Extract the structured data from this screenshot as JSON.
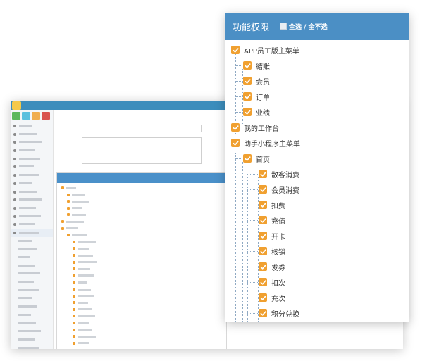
{
  "panel": {
    "title": "功能权限",
    "select_all": "全选",
    "separator": " / ",
    "deselect_all": "全不选"
  },
  "tree": [
    {
      "label": "APP员工版主菜单",
      "level": 0,
      "checked": true
    },
    {
      "label": "結账",
      "level": 1,
      "checked": true
    },
    {
      "label": "会员",
      "level": 1,
      "checked": true
    },
    {
      "label": "订单",
      "level": 1,
      "checked": true
    },
    {
      "label": "业绩",
      "level": 1,
      "checked": true
    },
    {
      "label": "我的工作台",
      "level": 0,
      "checked": true
    },
    {
      "label": "助手小程序主菜单",
      "level": 0,
      "checked": true
    },
    {
      "label": "首页",
      "level": 1,
      "checked": true
    },
    {
      "label": "散客消费",
      "level": 2,
      "checked": true
    },
    {
      "label": "会员消费",
      "level": 2,
      "checked": true
    },
    {
      "label": "扣费",
      "level": 2,
      "checked": true
    },
    {
      "label": "充值",
      "level": 2,
      "checked": true
    },
    {
      "label": "开卡",
      "level": 2,
      "checked": true
    },
    {
      "label": "核销",
      "level": 2,
      "checked": true
    },
    {
      "label": "发券",
      "level": 2,
      "checked": true
    },
    {
      "label": "扣次",
      "level": 2,
      "checked": true
    },
    {
      "label": "充次",
      "level": 2,
      "checked": true
    },
    {
      "label": "积分兑换",
      "level": 2,
      "checked": true
    }
  ],
  "colors": {
    "header": "#4b8fc5",
    "checkbox": "#f0a030",
    "topbar": "#3c8dbc"
  },
  "icons": {
    "checkbox": "checkmark-icon",
    "select_all_box": "square-icon"
  }
}
